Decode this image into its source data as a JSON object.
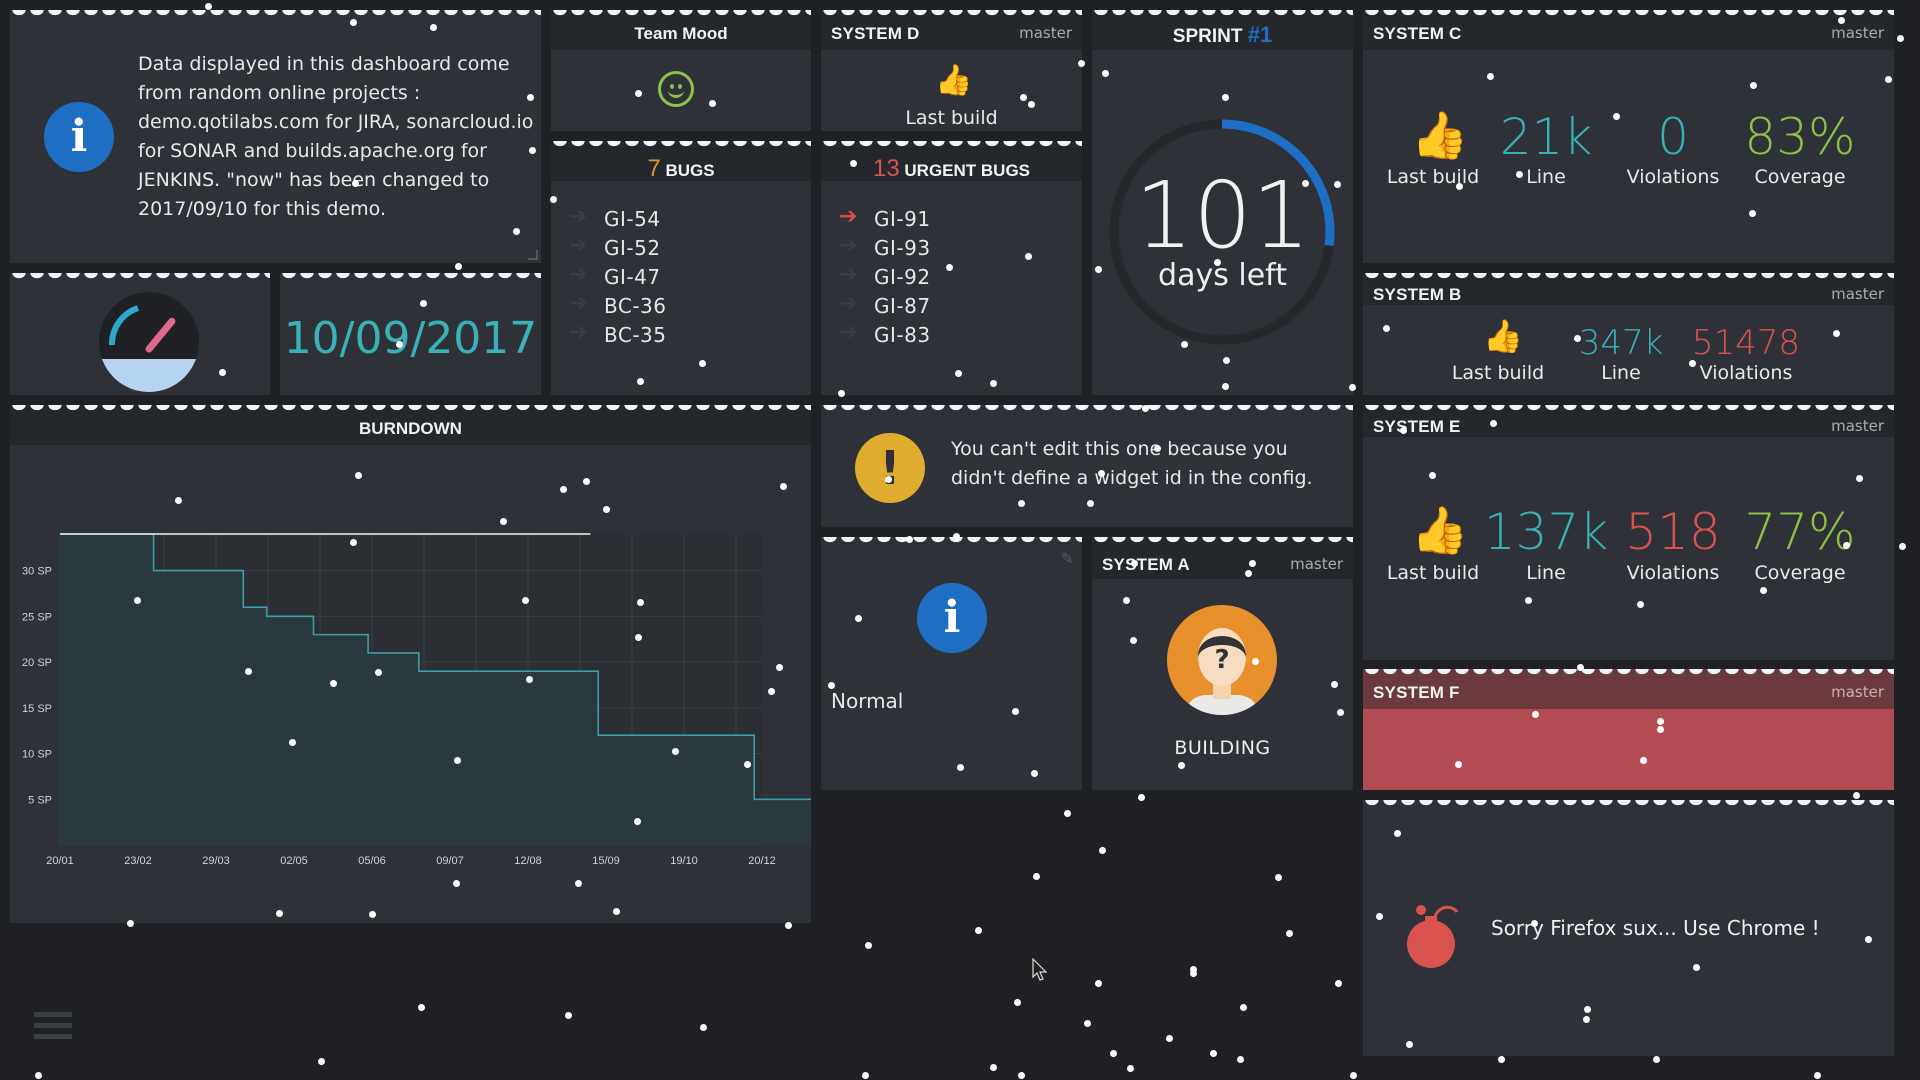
{
  "info": {
    "text": "Data displayed in this dashboard come from random online projects : demo.qotilabs.com for JIRA, sonarcloud.io for SONAR and builds.apache.org for JENKINS. \"now\" has been changed to 2017/09/10 for this demo."
  },
  "team_mood": {
    "title": "Team Mood"
  },
  "date": {
    "value": "10/09/2017"
  },
  "system_d": {
    "title": "SYSTEM D",
    "branch": "master",
    "build_label": "Last build"
  },
  "bugs": {
    "count": "7",
    "title": "BUGS",
    "items": [
      "GI-54",
      "GI-52",
      "GI-47",
      "BC-36",
      "BC-35"
    ]
  },
  "urgent_bugs": {
    "count": "13",
    "title": "URGENT BUGS",
    "items": [
      "GI-91",
      "GI-93",
      "GI-92",
      "GI-87",
      "GI-83"
    ]
  },
  "sprint": {
    "title": "SPRINT",
    "number": "#1",
    "days": "101",
    "days_label": "days left",
    "progress": 0.27
  },
  "system_c": {
    "title": "SYSTEM C",
    "branch": "master",
    "build_label": "Last build",
    "line": "21k",
    "line_label": "Line",
    "violations": "0",
    "violations_label": "Violations",
    "coverage": "83%",
    "coverage_label": "Coverage"
  },
  "system_b": {
    "title": "SYSTEM B",
    "branch": "master",
    "build_label": "Last build",
    "line": "347k",
    "line_label": "Line",
    "violations": "51478",
    "violations_label": "Violations"
  },
  "system_e": {
    "title": "SYSTEM E",
    "branch": "master",
    "build_label": "Last build",
    "line": "137k",
    "line_label": "Line",
    "violations": "518",
    "violations_label": "Violations",
    "coverage": "77%",
    "coverage_label": "Coverage"
  },
  "system_f": {
    "title": "SYSTEM F",
    "branch": "master"
  },
  "system_a": {
    "title": "SYSTEM A",
    "branch": "master",
    "status": "BUILDING"
  },
  "warning": {
    "text": "You can't edit this one because you didn't define a widget id in the config."
  },
  "normal": {
    "label": "Normal"
  },
  "firefox": {
    "text": "Sorry Firefox sux... Use Chrome !"
  },
  "gauge": {
    "level": 0.72
  },
  "colors": {
    "teal": "#3ab1b7",
    "red": "#d9534f",
    "green": "#8bc34a",
    "blue": "#1e6fc4",
    "amber": "#e0ac30",
    "orange": "#e8912c"
  },
  "chart_data": {
    "type": "line",
    "title": "BURNDOWN",
    "x_labels": [
      "20/01",
      "23/02",
      "29/03",
      "02/05",
      "05/06",
      "09/07",
      "12/08",
      "15/09",
      "19/10",
      "20/12"
    ],
    "y_labels": [
      "5 SP",
      "10 SP",
      "15 SP",
      "20 SP",
      "25 SP",
      "30 SP"
    ],
    "ylim": [
      0,
      34
    ],
    "ideal_line": {
      "value": 34,
      "x_end_index": 6.8
    },
    "series": [
      {
        "values": [
          [
            0.0,
            34
          ],
          [
            1.2,
            34
          ],
          [
            1.2,
            30
          ],
          [
            2.35,
            30
          ],
          [
            2.35,
            26
          ],
          [
            2.65,
            26
          ],
          [
            2.65,
            25
          ],
          [
            3.25,
            25
          ],
          [
            3.25,
            23
          ],
          [
            3.95,
            23
          ],
          [
            3.95,
            21
          ],
          [
            4.6,
            21
          ],
          [
            4.6,
            19
          ],
          [
            6.9,
            19
          ],
          [
            6.9,
            12
          ],
          [
            8.9,
            12
          ],
          [
            8.9,
            5
          ],
          [
            9.9,
            5
          ],
          [
            9.9,
            0
          ]
        ]
      }
    ],
    "grid": true
  }
}
